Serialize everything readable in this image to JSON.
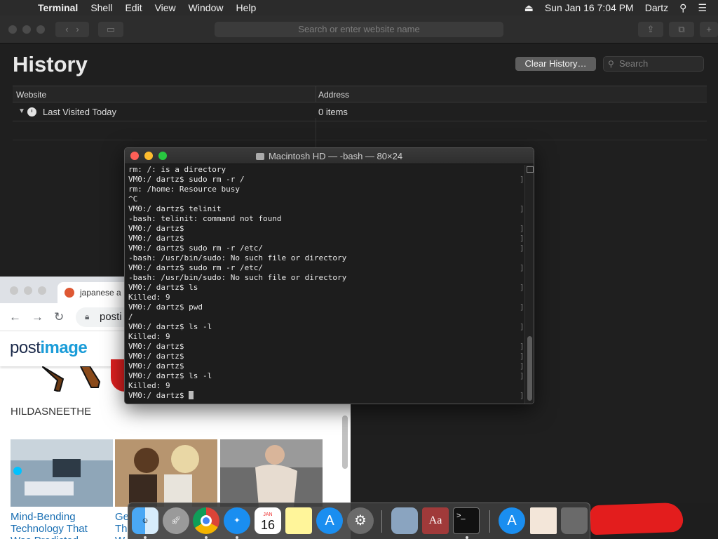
{
  "menubar": {
    "app": "Terminal",
    "items": [
      "Shell",
      "Edit",
      "View",
      "Window",
      "Help"
    ],
    "clock": "Sun Jan 16  7:04 PM",
    "user": "Dartz"
  },
  "safari": {
    "address_placeholder": "Search or enter website name",
    "title": "History",
    "clear_label": "Clear History…",
    "search_placeholder": "Search",
    "col_website": "Website",
    "col_address": "Address",
    "row_label": "Last Visited Today",
    "row_count": "0 items"
  },
  "chrome": {
    "tab_label": "japanese a",
    "url": "posti",
    "logo": {
      "a": "post",
      "b": "image"
    },
    "heading": "HILDASNEETHE",
    "caption1": "Mind-Bending\nTechnology That\nWas Predicted",
    "caption2": "Ge\nTh\nW"
  },
  "terminal": {
    "title": "Macintosh HD — -bash — 80×24",
    "lines": [
      "rm: /: is a directory",
      "VM0:/ dartz$ sudo rm -r /",
      "rm: /home: Resource busy",
      "^C",
      "VM0:/ dartz$ telinit",
      "-bash: telinit: command not found",
      "VM0:/ dartz$",
      "VM0:/ dartz$",
      "VM0:/ dartz$ sudo rm -r /etc/",
      "-bash: /usr/bin/sudo: No such file or directory",
      "VM0:/ dartz$ sudo rm -r /etc/",
      "-bash: /usr/bin/sudo: No such file or directory",
      "VM0:/ dartz$ ls",
      "Killed: 9",
      "VM0:/ dartz$ pwd",
      "/",
      "VM0:/ dartz$ ls -l",
      "Killed: 9",
      "VM0:/ dartz$",
      "VM0:/ dartz$",
      "VM0:/ dartz$",
      "VM0:/ dartz$ ls -l",
      "Killed: 9",
      "VM0:/ dartz$ "
    ]
  },
  "dock": {
    "calendar_month": "JAN",
    "calendar_day": "16",
    "items": [
      "finder-icon",
      "launchpad-icon",
      "chrome-icon",
      "safari-icon",
      "calendar-icon",
      "notes-icon",
      "app-store-icon",
      "system-preferences-icon",
      "preview-icon",
      "dictionary-icon",
      "terminal-icon",
      "app-store-downloads-icon",
      "image-file-icon",
      "trash-icon"
    ]
  }
}
